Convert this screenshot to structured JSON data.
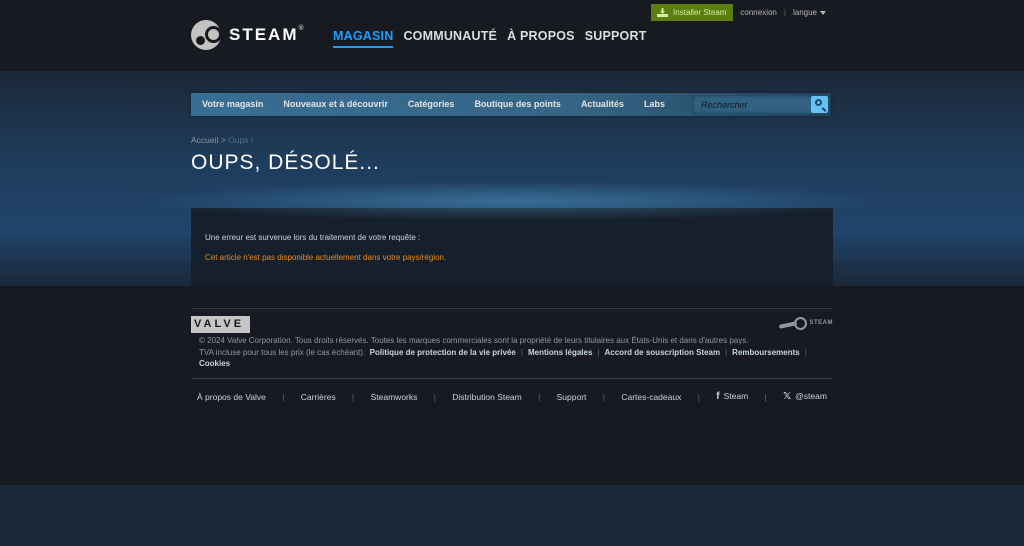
{
  "header": {
    "logo_text": "STEAM",
    "logo_tm": "®",
    "nav": [
      {
        "label": "MAGASIN",
        "active": true
      },
      {
        "label": "COMMUNAUTÉ"
      },
      {
        "label": "À PROPOS"
      },
      {
        "label": "SUPPORT"
      }
    ],
    "install_label": "Installer Steam",
    "login_label": "connexion",
    "separator": "|",
    "language_label": "langue"
  },
  "store_nav": {
    "items": [
      "Votre magasin",
      "Nouveaux et à découvrir",
      "Catégories",
      "Boutique des points",
      "Actualités",
      "Labs"
    ],
    "search_placeholder": "Rechercher"
  },
  "breadcrumb": {
    "home": "Accueil",
    "separator": ">",
    "current": "Oups !"
  },
  "page_title": "OUPS, DÉSOLÉ...",
  "error": {
    "intro": "Une erreur est survenue lors du traitement de votre requête :",
    "message": "Cet article n'est pas disponible actuellement dans votre pays/région."
  },
  "footer": {
    "valve_logo": "VALVE",
    "steam_logo": "STEAM",
    "copyright": "© 2024 Valve Corporation. Tous droits réservés. Toutes les marques commerciales sont la propriété de leurs titulaires aux États-Unis et dans d'autres pays.",
    "vat": "TVA incluse pour tous les prix (le cas échéant).",
    "legal_links": [
      "Politique de protection de la vie privée",
      "Mentions légales",
      "Accord de souscription Steam",
      "Remboursements",
      "Cookies"
    ],
    "bottom_links": [
      "À propos de Valve",
      "Carrières",
      "Steamworks",
      "Distribution Steam",
      "Support",
      "Cartes-cadeaux",
      "Steam",
      "@steam"
    ]
  },
  "colors": {
    "accent": "#1a9fff",
    "install_green": "#5c7e10",
    "error_orange": "#e68b1e"
  }
}
